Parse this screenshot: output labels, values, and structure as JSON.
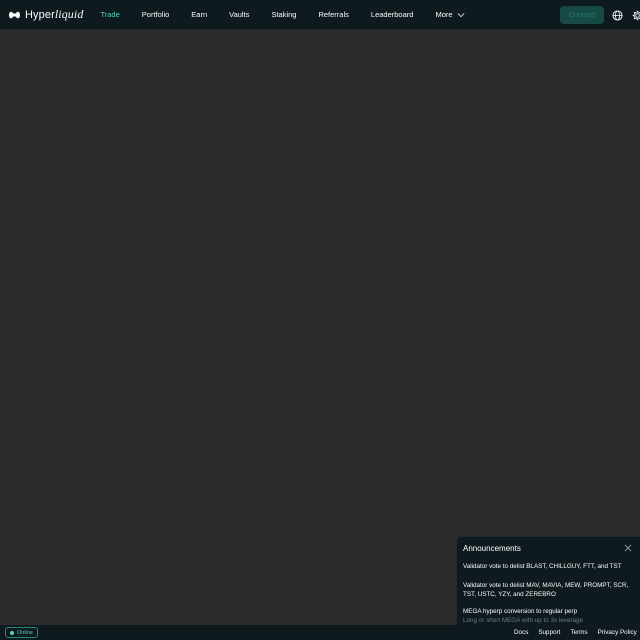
{
  "brand": {
    "name_prefix": "Hyper",
    "name_suffix": "liquid"
  },
  "nav": {
    "items": [
      {
        "label": "Trade",
        "active": true
      },
      {
        "label": "Portfolio"
      },
      {
        "label": "Earn"
      },
      {
        "label": "Vaults"
      },
      {
        "label": "Staking"
      },
      {
        "label": "Referrals"
      },
      {
        "label": "Leaderboard"
      }
    ],
    "more_label": "More"
  },
  "toolbar": {
    "connect_label": "Connect",
    "icons": [
      "globe-icon",
      "gear-icon"
    ]
  },
  "announcements": {
    "title": "Announcements",
    "items": [
      {
        "title": "Validator vote to delist BLAST, CHILLGUY, FTT, and TST"
      },
      {
        "title": "Validator vote to delist MAV, MAVIA, MEW, PROMPT, SCR, TST, USTC, YZY, and ZEREBRO"
      },
      {
        "title": "MEGA hyperp conversion to regular perp",
        "subtitle": "Long or short MEGA with up to 3x leverage"
      }
    ]
  },
  "footer": {
    "status_label": "Online",
    "links": [
      "Docs",
      "Support",
      "Terms",
      "Privacy Policy"
    ]
  },
  "colors": {
    "accent": "#50d2c1",
    "background": "#2b2b2b",
    "surface": "#0f1a1f",
    "connect_button": "#174a45"
  }
}
